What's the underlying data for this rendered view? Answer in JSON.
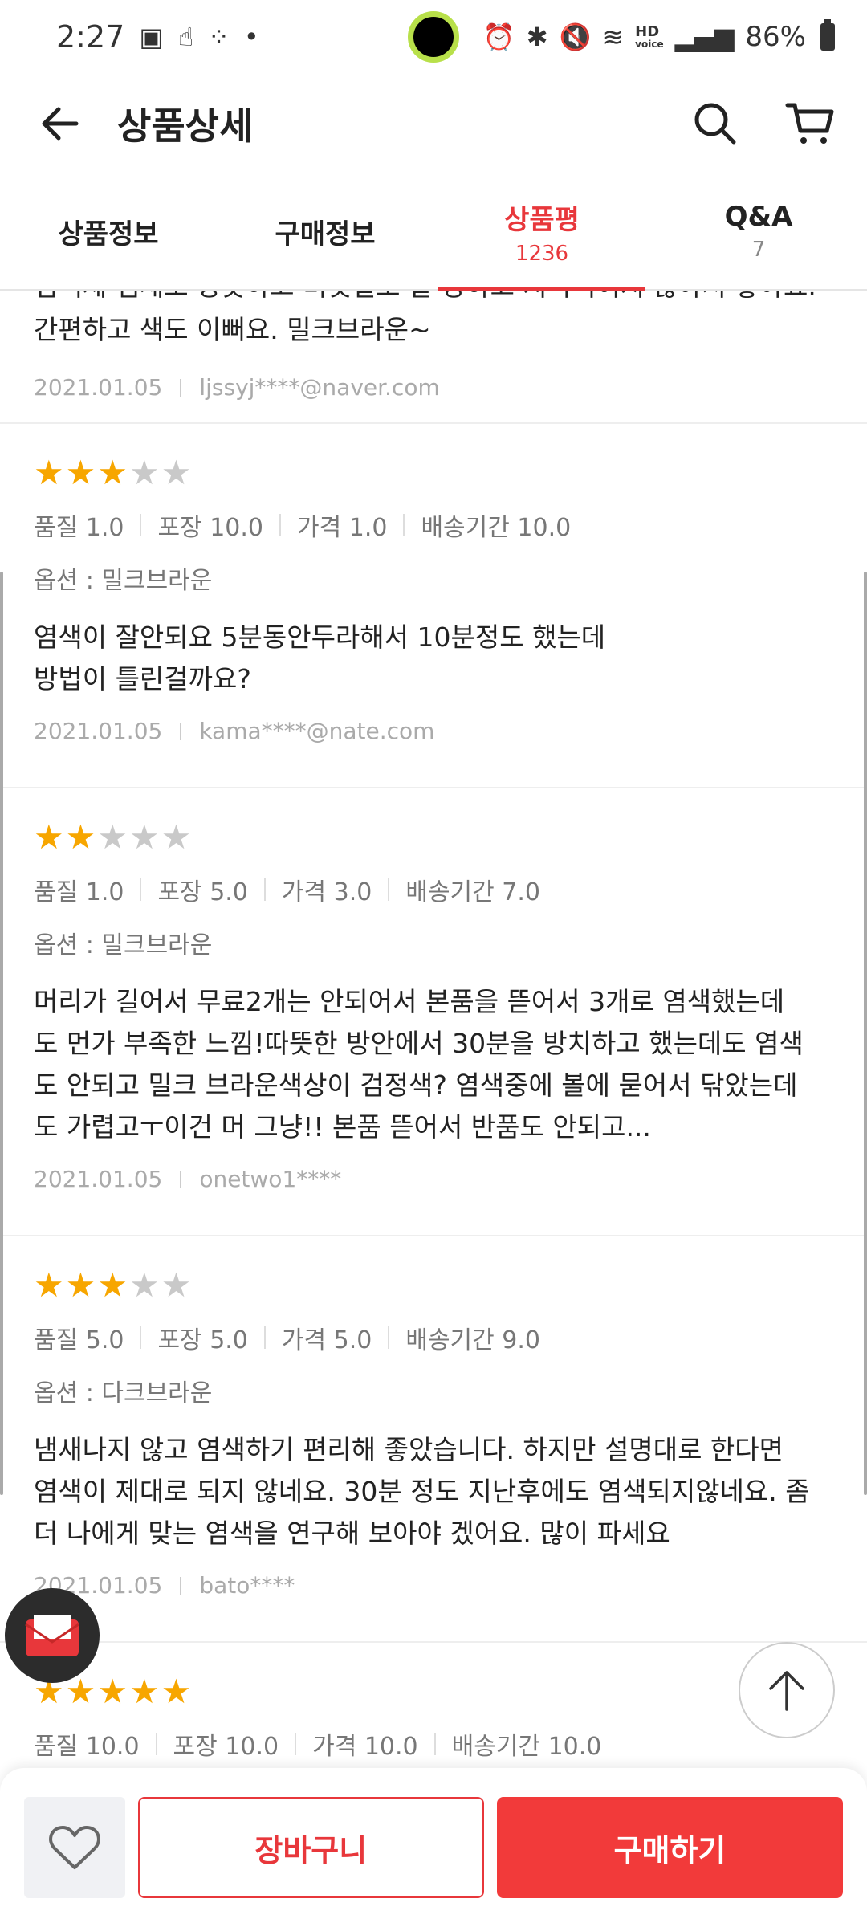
{
  "status": {
    "time": "2:27",
    "hd_label": "HD",
    "voice_label": "voice",
    "battery": "86%"
  },
  "header": {
    "title": "상품상세"
  },
  "tabs": [
    {
      "label": "상품정보",
      "count": ""
    },
    {
      "label": "구매정보",
      "count": ""
    },
    {
      "label": "상품평",
      "count": "1236"
    },
    {
      "label": "Q&A",
      "count": "7"
    }
  ],
  "active_tab": 2,
  "reviews": [
    {
      "partial_text": "염색제 냄새도 향긋하고 비닛열도 잘 당하고 지극적이지 않아서 좋아요. 간편하고 색도 이뻐요. 밀크브라운~",
      "date": "2021.01.05",
      "user": "ljssyj****@naver.com"
    },
    {
      "rating": 3,
      "scores": [
        "품질 1.0",
        "포장 10.0",
        "가격 1.0",
        "배송기간 10.0"
      ],
      "option": "옵션 : 밀크브라운",
      "text_lines": [
        "염색이 잘안되요 5분동안두라해서 10분정도 했는데",
        "방법이 틀린걸까요?"
      ],
      "date": "2021.01.05",
      "user": "kama****@nate.com"
    },
    {
      "rating": 2,
      "scores": [
        "품질 1.0",
        "포장 5.0",
        "가격 3.0",
        "배송기간 7.0"
      ],
      "option": "옵션 : 밀크브라운",
      "text_lines": [
        "머리가 길어서 무료2개는 안되어서 본품을 뜯어서 3개로 염색했는데",
        "도 먼가 부족한 느낌!따뜻한 방안에서 30분을 방치하고 했는데도 염색",
        "도 안되고 밀크 브라운색상이 검정색? 염색중에 볼에 묻어서 닦았는데",
        "도 가렵고ㅜ이건 머 그냥!! 본품 뜯어서 반품도 안되고..."
      ],
      "date": "2021.01.05",
      "user": "onetwo1****"
    },
    {
      "rating": 3,
      "scores": [
        "품질 5.0",
        "포장 5.0",
        "가격 5.0",
        "배송기간 9.0"
      ],
      "option": "옵션 : 다크브라운",
      "text_lines": [
        "냄새나지 않고 염색하기 편리해 좋았습니다. 하지만 설명대로 한다면",
        "염색이 제대로 되지 않네요. 30분 정도 지난후에도 염색되지않네요. 좀",
        "더 나에게 맞는 염색을 연구해 보아야 겠어요. 많이 파세요"
      ],
      "date": "2021.01.05",
      "user": "bato****"
    },
    {
      "rating": 5,
      "scores": [
        "품질 10.0",
        "포장 10.0",
        "가격 10.0",
        "배송기간 10.0"
      ]
    }
  ],
  "bottom_bar": {
    "cart_label": "장바구니",
    "buy_label": "구매하기"
  },
  "colors": {
    "accent": "#e8373b",
    "buy_button": "#f23a3a",
    "star_on": "#f7a600",
    "star_off": "#c9c9c9"
  },
  "icons": [
    "back-arrow-icon",
    "search-icon",
    "cart-icon",
    "heart-icon",
    "mail-icon",
    "arrow-up-icon"
  ]
}
